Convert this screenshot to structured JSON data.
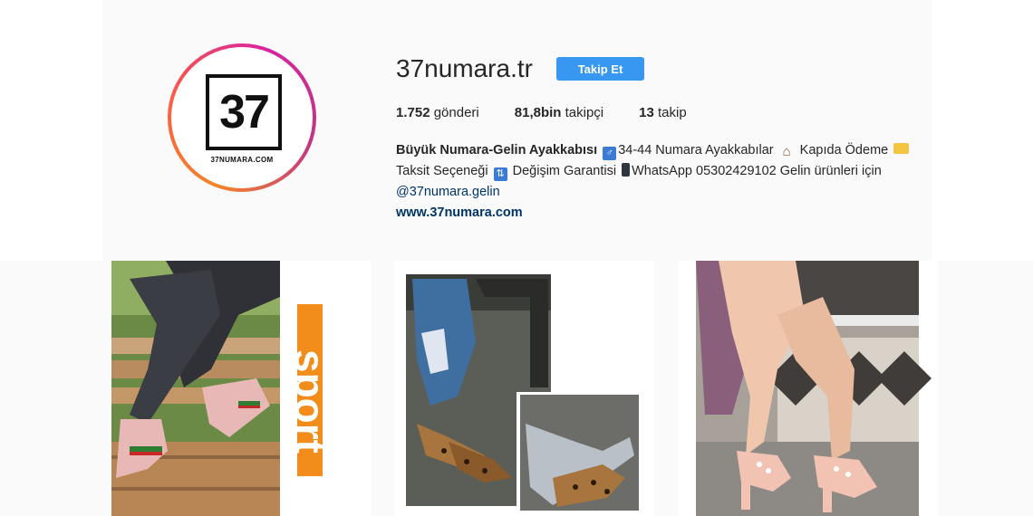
{
  "profile": {
    "username": "37numara.tr",
    "follow_label": "Takip Et",
    "logo_number": "37",
    "logo_caption": "37NUMARA.COM",
    "avatar_icon": "brand-logo"
  },
  "stats": {
    "posts_count": "1.752",
    "posts_label": "gönderi",
    "followers_count": "81,8bin",
    "followers_label": "takipçi",
    "following_count": "13",
    "following_label": "takip"
  },
  "bio": {
    "name": "Büyük Numara-Gelin Ayakkabısı",
    "part1": "34-44 Numara Ayakkabılar",
    "part2": "Kapıda Ödeme",
    "part3": "Taksit Seçeneği",
    "part4": "Değişim Garantisi",
    "part5": "WhatsApp 05302429102 Gelin ürünleri için",
    "mention": "@37numara.gelin",
    "website": "www.37numara.com",
    "emoji_icons": [
      "restroom-icon",
      "house-icon",
      "credit-card-icon",
      "arrows-icon",
      "mobile-phone-icon"
    ]
  },
  "posts": [
    {
      "overlay_text": "sport",
      "accent": "#f28c1b"
    },
    {
      "overlay_text": ""
    },
    {
      "overlay_text": ""
    }
  ],
  "colors": {
    "accent": "#3897f0",
    "link": "#003569",
    "background": "#fafafa"
  }
}
